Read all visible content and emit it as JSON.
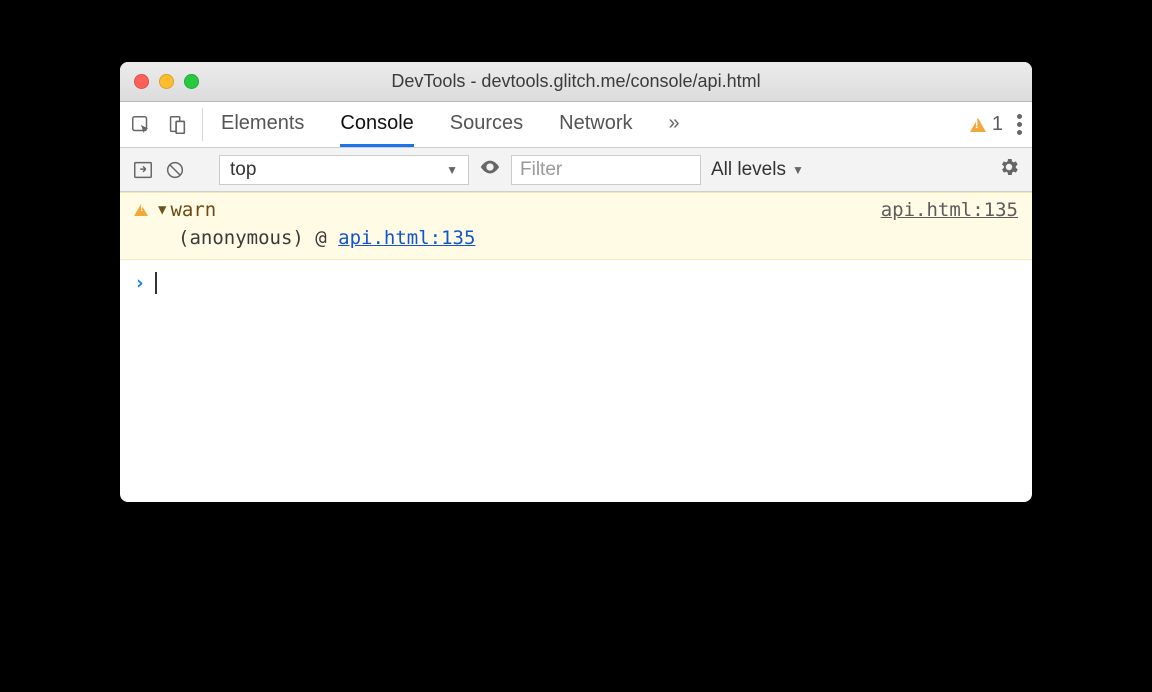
{
  "window": {
    "title": "DevTools - devtools.glitch.me/console/api.html"
  },
  "tabs": {
    "elements": "Elements",
    "console": "Console",
    "sources": "Sources",
    "network": "Network"
  },
  "warnings": {
    "count": "1"
  },
  "toolbar": {
    "context": "top",
    "filter_placeholder": "Filter",
    "levels": "All levels"
  },
  "log": {
    "message": "warn",
    "source": "api.html:135",
    "stack_prefix": "(anonymous) @ ",
    "stack_link": "api.html:135"
  },
  "prompt": {
    "chevron": "›"
  }
}
